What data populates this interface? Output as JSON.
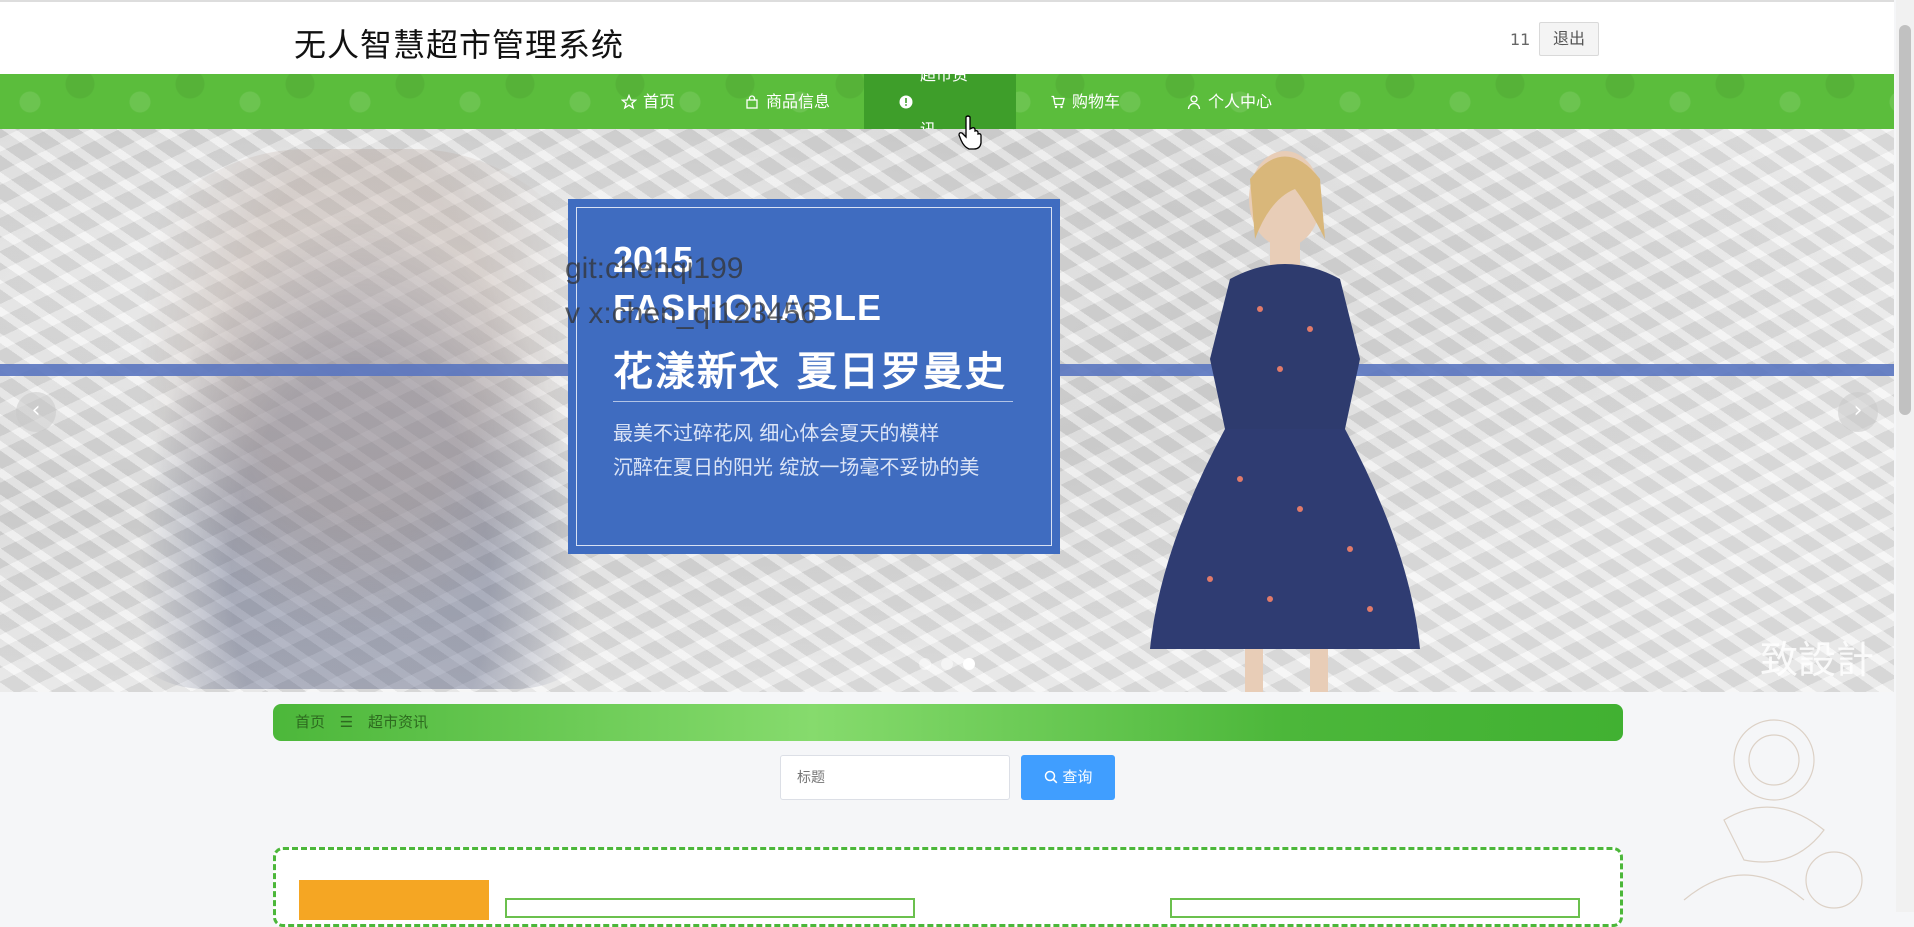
{
  "header": {
    "site_title": "无人智慧超市管理系统",
    "user_id": "11",
    "logout_label": "退出"
  },
  "nav": {
    "items": [
      {
        "label": "首页",
        "icon": "star-icon"
      },
      {
        "label": "商品信息",
        "icon": "bag-icon"
      },
      {
        "label": "超市资讯",
        "icon": "info-icon",
        "active": true
      },
      {
        "label": "购物车",
        "icon": "cart-icon"
      },
      {
        "label": "个人中心",
        "icon": "user-icon"
      }
    ]
  },
  "banner": {
    "year": "2015",
    "fashion": "FASHIONABLE",
    "headline": "花漾新衣  夏日罗曼史",
    "line1": "最美不过碎花风 细心体会夏天的模样",
    "line2": "沉醉在夏日的阳光 绽放一场毫不妥协的美",
    "watermark1": "git:chenqi199",
    "watermark2": "v x:chen_qi123456",
    "brand_mark": "致設計",
    "prev_symbol": "‹",
    "next_symbol": "›",
    "dots": 3,
    "active_dot": 3
  },
  "breadcrumb": {
    "home": "首页",
    "separator": "☰",
    "current": "超市资讯"
  },
  "search": {
    "placeholder": "标题",
    "button_label": "查询"
  },
  "colors": {
    "nav_green": "#5bbd3c",
    "nav_active": "#3e9e2a",
    "search_button": "#409eff",
    "panel_border": "#4cb73a",
    "orange_tag": "#f5a623",
    "promo_blue": "#3f6cc0"
  }
}
